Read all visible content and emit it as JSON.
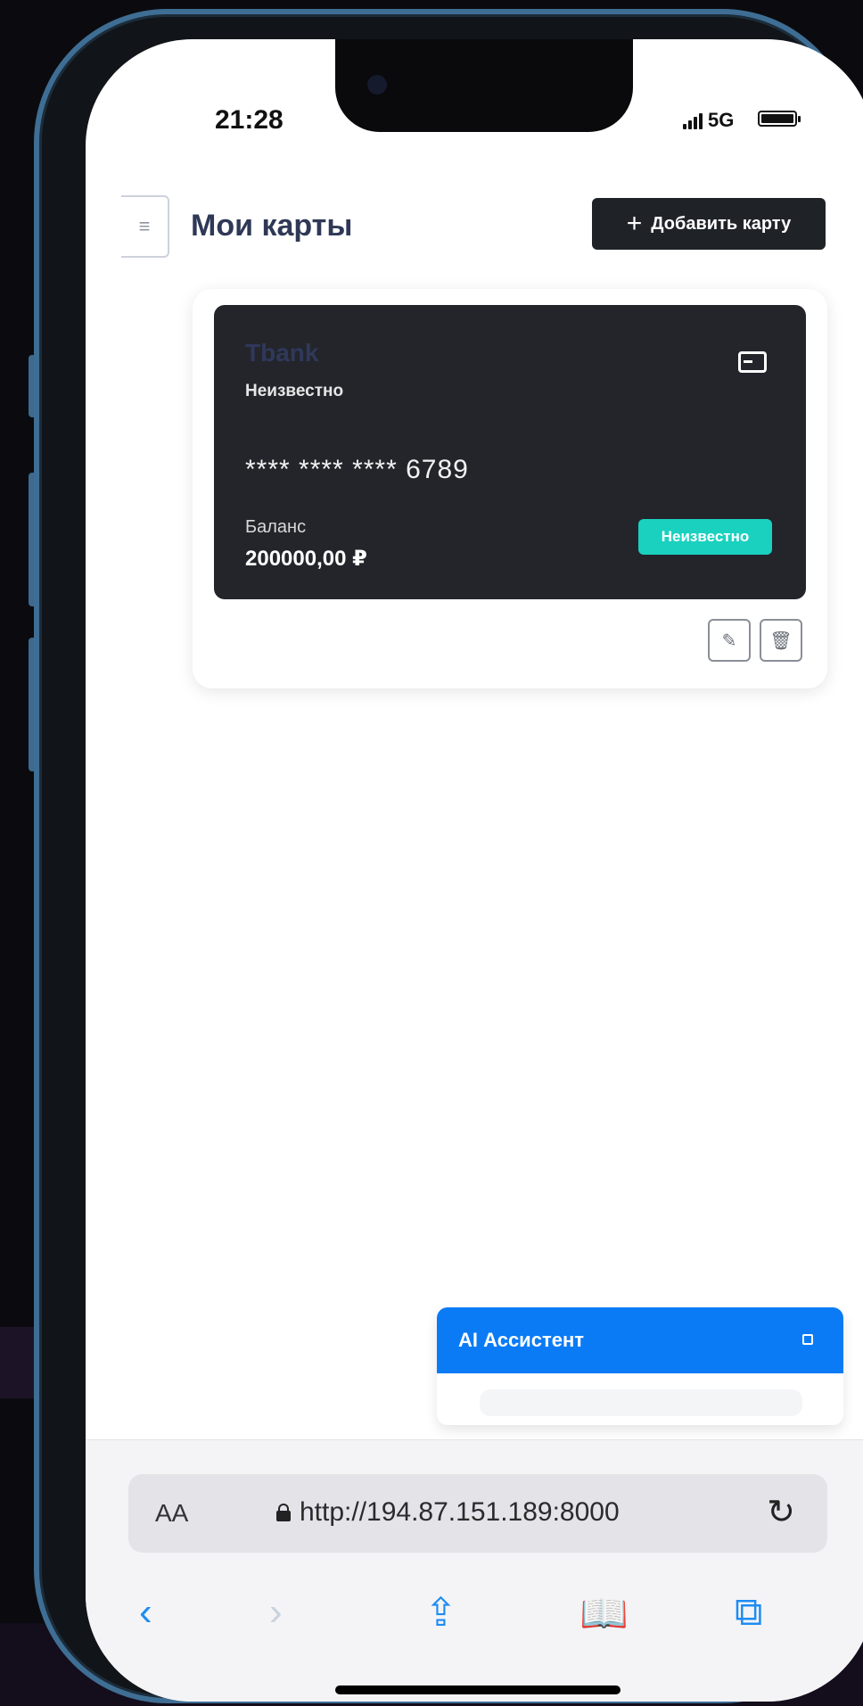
{
  "status_bar": {
    "time": "21:28",
    "network": "5G"
  },
  "header": {
    "menu_icon": "hamburger-icon",
    "title": "Мои карты",
    "add_button_label": "Добавить карту",
    "add_button_icon": "+"
  },
  "card": {
    "bank_name": "Tbank",
    "card_type": "Неизвестно",
    "number": "**** **** **** 6789",
    "balance_label": "Баланс",
    "balance_value": "200000,00 ₽",
    "status": "Неизвестно",
    "status_color": "#1ad1c0",
    "actions": [
      "edit-icon",
      "trash-icon"
    ]
  },
  "assistant": {
    "title": "AI Ассистент",
    "accent": "#0b7bf5"
  },
  "browser": {
    "aa_label": "AA",
    "url": "http://194.87.151.189:8000",
    "nav_icons": [
      "back-icon",
      "forward-icon",
      "share-icon",
      "bookmarks-icon",
      "tabs-icon"
    ]
  }
}
